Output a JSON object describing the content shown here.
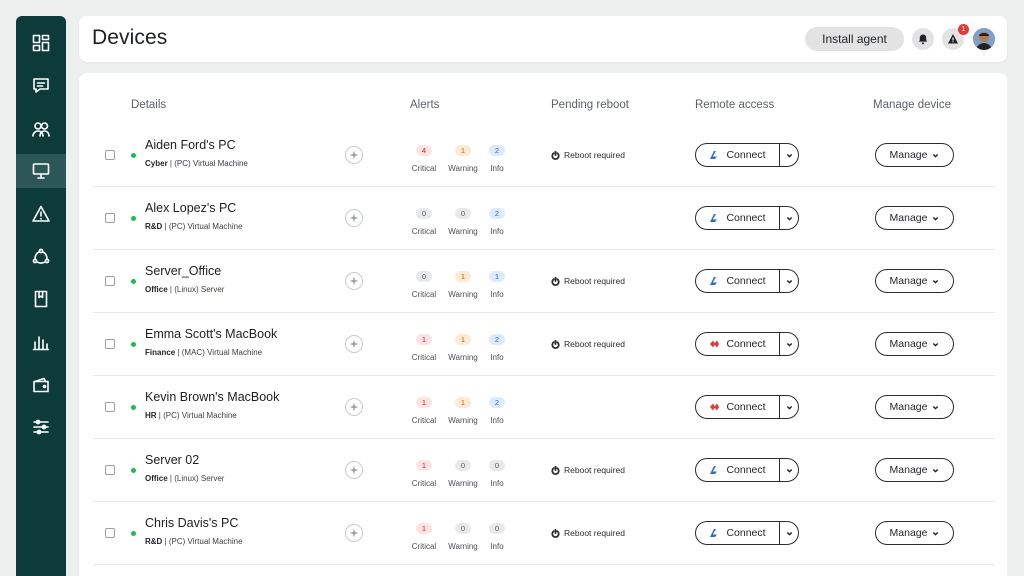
{
  "sidebar": {
    "items": [
      {
        "icon": "dashboard-icon",
        "active": false
      },
      {
        "icon": "chat-icon",
        "active": false
      },
      {
        "icon": "users-icon",
        "active": false
      },
      {
        "icon": "devices-icon",
        "active": true
      },
      {
        "icon": "alert-icon",
        "active": false
      },
      {
        "icon": "automation-icon",
        "active": false
      },
      {
        "icon": "book-icon",
        "active": false
      },
      {
        "icon": "reports-icon",
        "active": false
      },
      {
        "icon": "wallet-icon",
        "active": false
      },
      {
        "icon": "settings-sliders-icon",
        "active": false
      }
    ]
  },
  "header": {
    "title": "Devices",
    "install_label": "Install agent",
    "notifications_icon": "bell-icon",
    "alerts_icon": "warning-icon",
    "alerts_badge": "1",
    "avatar_icon": "user-avatar"
  },
  "table": {
    "columns": {
      "details": "Details",
      "alerts": "Alerts",
      "reboot": "Pending reboot",
      "remote": "Remote access",
      "manage": "Manage device"
    },
    "alert_labels": {
      "critical": "Critical",
      "warning": "Warning",
      "info": "Info"
    },
    "connect_label": "Connect",
    "manage_label": "Manage",
    "rows": [
      {
        "name": "Aiden Ford's PC",
        "group": "Cyber",
        "type": "(PC) Virtual Machine",
        "critical": "4",
        "warning": "1",
        "info": "2",
        "reboot": "Reboot required",
        "connect_icon": "blue"
      },
      {
        "name": "Alex Lopez's PC",
        "group": "R&D",
        "type": "(PC) Virtual Machine",
        "critical": "0",
        "warning": "0",
        "info": "2",
        "reboot": "",
        "connect_icon": "blue"
      },
      {
        "name": "Server_Office",
        "group": "Office",
        "type": "(Linux) Server",
        "critical": "0",
        "warning": "1",
        "info": "1",
        "reboot": "Reboot required",
        "connect_icon": "blue"
      },
      {
        "name": "Emma Scott's MacBook",
        "group": "Finance",
        "type": "(MAC) Virtual Machine",
        "critical": "1",
        "warning": "1",
        "info": "2",
        "reboot": "Reboot required",
        "connect_icon": "red"
      },
      {
        "name": "Kevin Brown's MacBook",
        "group": "HR",
        "type": "(PC) Virtual Machine",
        "critical": "1",
        "warning": "1",
        "info": "2",
        "reboot": "",
        "connect_icon": "red"
      },
      {
        "name": "Server 02",
        "group": "Office",
        "type": "(Linux) Server",
        "critical": "1",
        "warning": "0",
        "info": "0",
        "reboot": "Reboot required",
        "connect_icon": "blue"
      },
      {
        "name": "Chris Davis's PC",
        "group": "R&D",
        "type": "(PC) Virtual Machine",
        "critical": "1",
        "warning": "0",
        "info": "0",
        "reboot": "Reboot required",
        "connect_icon": "blue"
      }
    ]
  },
  "colors": {
    "sidebar_bg": "#0d3b3a",
    "status_online": "#1db954",
    "critical": "#c62828",
    "warning": "#b66a12",
    "info": "#2f6cc7",
    "connect_blue": "#2f6cc7",
    "connect_red": "#e53935"
  }
}
